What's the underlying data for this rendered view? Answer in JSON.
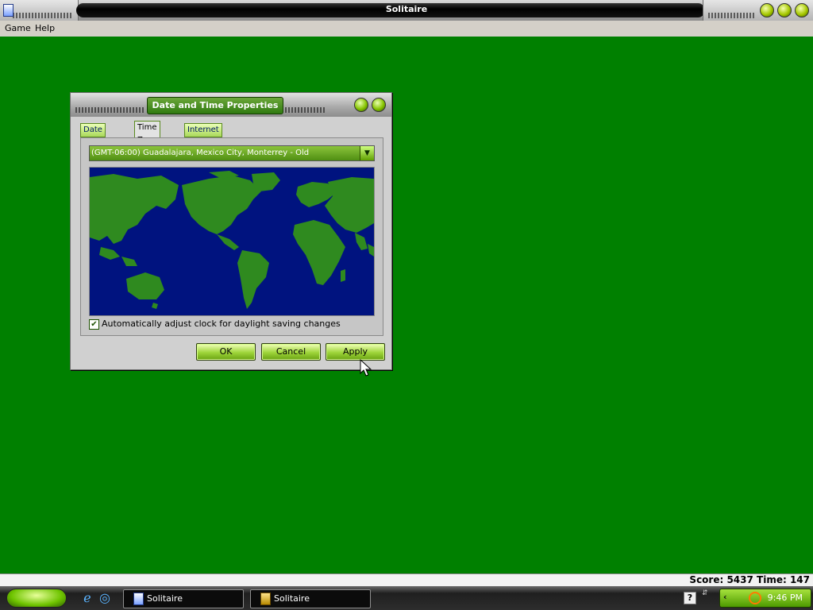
{
  "window": {
    "title": "Solitaire"
  },
  "menu": {
    "items": [
      "Game",
      "Help"
    ]
  },
  "status": {
    "text": "Score: 5437 Time: 147"
  },
  "taskbar": {
    "buttons": [
      {
        "label": "Solitaire",
        "icon": "solitaire-card-icon"
      },
      {
        "label": "Solitaire",
        "icon": "tray-app-icon"
      }
    ],
    "clock": "9:46 PM",
    "quicklaunch": [
      "internet-explorer-icon",
      "desktop-icon"
    ]
  },
  "dialog": {
    "title": "Date and Time Properties",
    "tabs": [
      {
        "label": "Date & Time",
        "active": false
      },
      {
        "label": "Time Zone",
        "active": true
      },
      {
        "label": "Internet Time",
        "active": false
      }
    ],
    "timezone_value": "(GMT-06:00) Guadalajara, Mexico City, Monterrey - Old",
    "dst_label": "Automatically adjust clock for daylight saving changes",
    "dst_checked": true,
    "ok_label": "OK",
    "cancel_label": "Cancel",
    "apply_label": "Apply"
  },
  "colors": {
    "felt": "#008000",
    "map_ocean": "#00137f",
    "map_land": "#2f8a1f",
    "accent_green": "#8cc43c"
  }
}
